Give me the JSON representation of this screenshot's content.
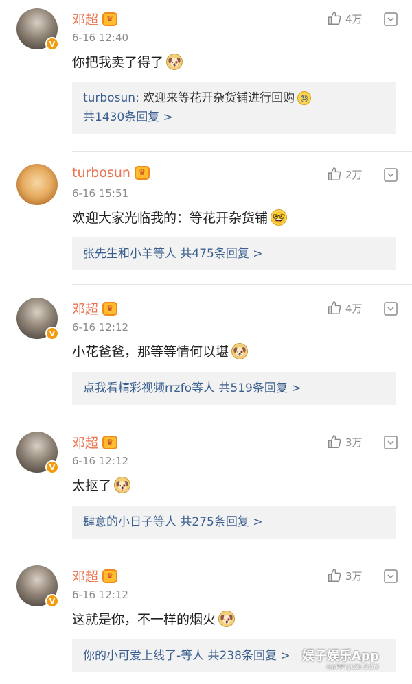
{
  "comments": [
    {
      "name": "邓超",
      "time": "6-16 12:40",
      "likes": "4万",
      "text": "你把我卖了得了",
      "reply_lines": [
        {
          "link": "turbosun",
          "plain": ": 欢迎来等花开杂货铺进行回购"
        },
        {
          "link": "共1430条回复 >"
        }
      ]
    },
    {
      "name": "turbosun",
      "time": "6-16 15:51",
      "likes": "2万",
      "text": "欢迎大家光临我的：等花开杂货铺",
      "reply_lines": [
        {
          "link": "张先生和小羊等人  共475条回复 >"
        }
      ]
    },
    {
      "name": "邓超",
      "time": "6-16 12:12",
      "likes": "4万",
      "text": "小花爸爸，那等等情何以堪",
      "reply_lines": [
        {
          "link": "点我看精彩视频rrzfo等人  共519条回复 >"
        }
      ]
    },
    {
      "name": "邓超",
      "time": "6-16 12:12",
      "likes": "3万",
      "text": "太抠了",
      "reply_lines": [
        {
          "link": "肆意的小日子等人  共275条回复 >"
        }
      ]
    },
    {
      "name": "邓超",
      "time": "6-16 12:12",
      "likes": "3万",
      "text": "这就是你，不一样的烟火",
      "reply_lines": [
        {
          "link": "你的小可爱上线了-等人  共238条回复 >"
        }
      ]
    }
  ],
  "watermark": {
    "text": "娱子娱乐App",
    "sub": "HAPPYJUZI.COM"
  },
  "colors": {
    "name": "#eb7350",
    "link": "#3a5f8f",
    "reply_bg": "#f2f2f2",
    "verified": "#f39b0c"
  }
}
